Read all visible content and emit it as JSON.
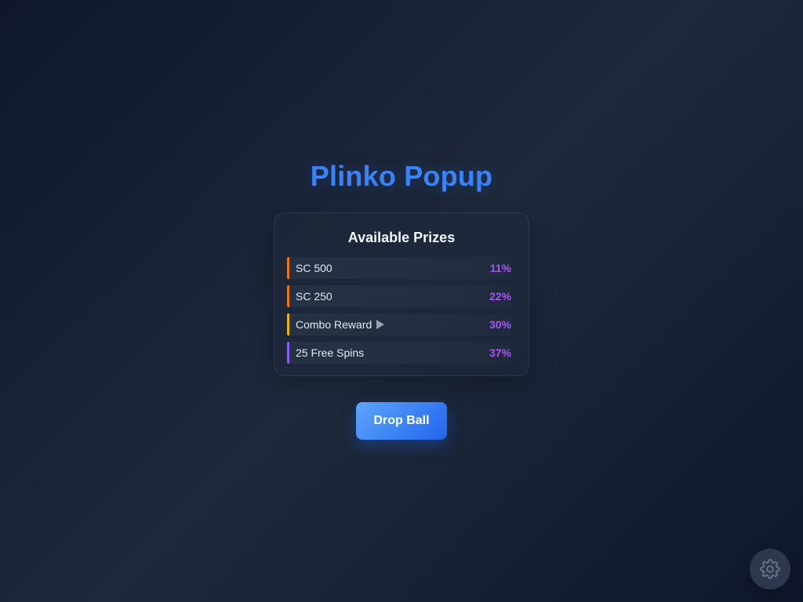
{
  "title": "Plinko Popup",
  "prizes_panel": {
    "title": "Available Prizes",
    "items": [
      {
        "label": "SC 500",
        "percent": "11%",
        "accent": "#f97316",
        "icon": ""
      },
      {
        "label": "SC 250",
        "percent": "22%",
        "accent": "#f97316",
        "icon": ""
      },
      {
        "label": "Combo Reward",
        "percent": "30%",
        "accent": "#eab308",
        "icon": "play-triangle-icon"
      },
      {
        "label": "25 Free Spins",
        "percent": "37%",
        "accent": "#8b5cf6",
        "icon": ""
      }
    ]
  },
  "actions": {
    "drop_label": "Drop Ball"
  },
  "settings": {
    "icon": "gear-icon"
  },
  "colors": {
    "title": "#3b82f6",
    "percent": "#a855f7",
    "button": "#3b82f6"
  }
}
